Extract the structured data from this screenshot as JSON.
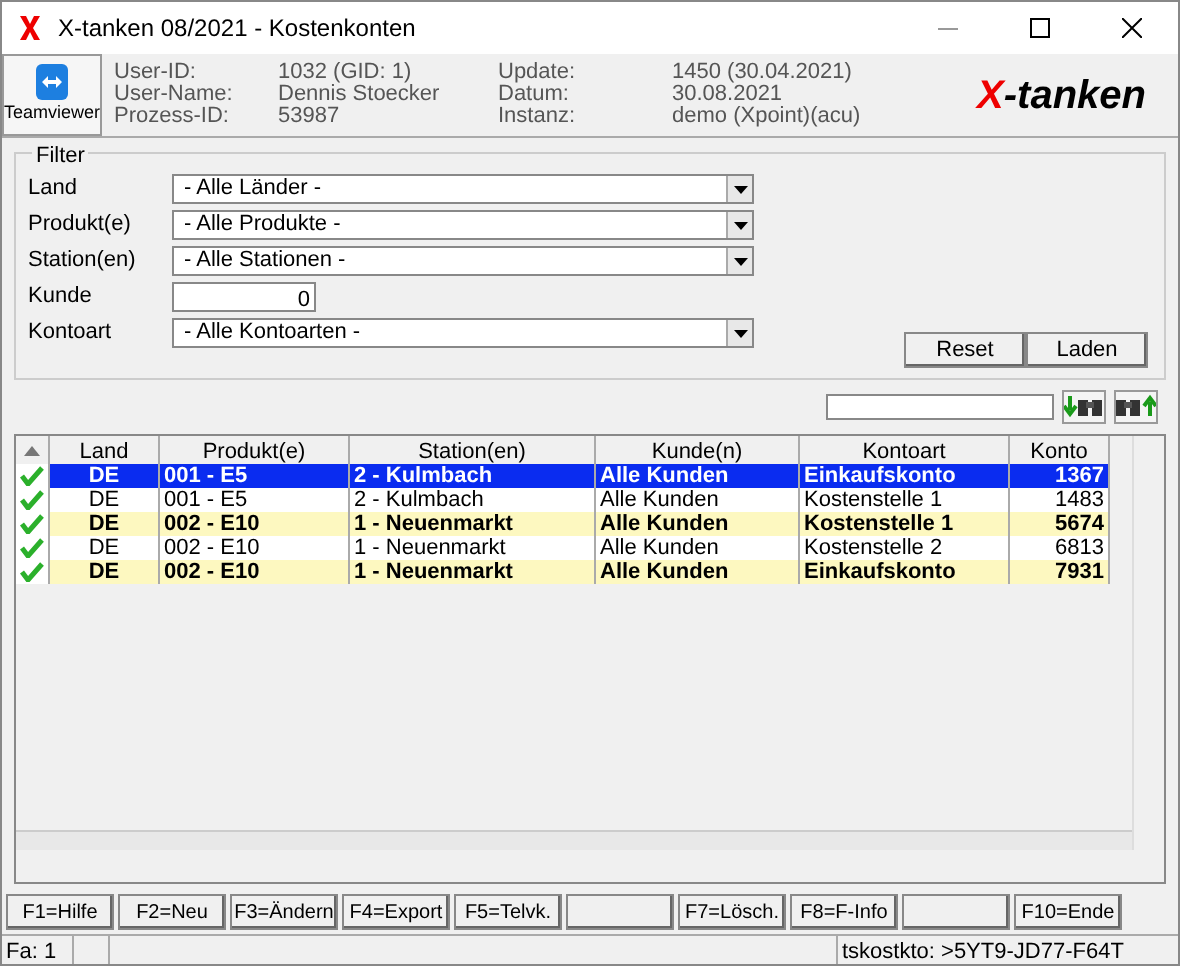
{
  "window": {
    "title": "X-tanken 08/2021 - Kostenkonten"
  },
  "header": {
    "teamviewer_label": "Teamviewer",
    "info_left": [
      {
        "label": "User-ID:",
        "value": "1032 (GID: 1)"
      },
      {
        "label": "User-Name:",
        "value": "Dennis Stoecker"
      },
      {
        "label": "Prozess-ID:",
        "value": "53987"
      }
    ],
    "info_right": [
      {
        "label": "Update:",
        "value": "1450 (30.04.2021)"
      },
      {
        "label": "Datum:",
        "value": "30.08.2021"
      },
      {
        "label": "Instanz:",
        "value": "demo (Xpoint)(acu)"
      }
    ],
    "logo_x": "X",
    "logo_rest": "-tanken"
  },
  "filter": {
    "title": "Filter",
    "fields": [
      {
        "kind": "dropdown",
        "label": "Land",
        "value": "- Alle Länder -"
      },
      {
        "kind": "dropdown",
        "label": "Produkt(e)",
        "value": "- Alle Produkte -"
      },
      {
        "kind": "dropdown",
        "label": "Station(en)",
        "value": "- Alle Stationen -"
      },
      {
        "kind": "number",
        "label": "Kunde",
        "value": "0"
      },
      {
        "kind": "dropdown",
        "label": "Kontoart",
        "value": "- Alle Kontoarten -"
      }
    ],
    "buttons": [
      "Reset",
      "Laden"
    ]
  },
  "table": {
    "columns": [
      "Land",
      "Produkt(e)",
      "Station(en)",
      "Kunde(n)",
      "Kontoart",
      "Konto"
    ],
    "rows": [
      {
        "selected": true,
        "highlighted": false,
        "checked": true,
        "cells": [
          "DE",
          "001 - E5",
          "2 - Kulmbach",
          "Alle Kunden",
          "Einkaufskonto",
          "1367"
        ]
      },
      {
        "selected": false,
        "highlighted": false,
        "checked": true,
        "cells": [
          "DE",
          "001 - E5",
          "2 - Kulmbach",
          "Alle Kunden",
          "Kostenstelle 1",
          "1483"
        ]
      },
      {
        "selected": false,
        "highlighted": true,
        "checked": true,
        "cells": [
          "DE",
          "002 - E10",
          "1 - Neuenmarkt",
          "Alle Kunden",
          "Kostenstelle 1",
          "5674"
        ]
      },
      {
        "selected": false,
        "highlighted": false,
        "checked": true,
        "cells": [
          "DE",
          "002 - E10",
          "1 - Neuenmarkt",
          "Alle Kunden",
          "Kostenstelle 2",
          "6813"
        ]
      },
      {
        "selected": false,
        "highlighted": true,
        "checked": true,
        "cells": [
          "DE",
          "002 - E10",
          "1 - Neuenmarkt",
          "Alle Kunden",
          "Einkaufskonto",
          "7931"
        ]
      }
    ]
  },
  "function_keys": [
    {
      "kind": "key",
      "label": "F1=Hilfe"
    },
    {
      "kind": "key",
      "label": "F2=Neu"
    },
    {
      "kind": "key",
      "label": "F3=Ändern"
    },
    {
      "kind": "key",
      "label": "F4=Export"
    },
    {
      "kind": "key",
      "label": "F5=Telvk."
    },
    {
      "kind": "blank"
    },
    {
      "kind": "key",
      "label": "F7=Lösch."
    },
    {
      "kind": "key",
      "label": "F8=F-Info"
    },
    {
      "kind": "blank"
    },
    {
      "kind": "key",
      "label": "F10=Ende"
    }
  ],
  "status_bar": {
    "left": "Fa: 1",
    "right": "tskostkto: >5YT9-JD77-F64T"
  }
}
